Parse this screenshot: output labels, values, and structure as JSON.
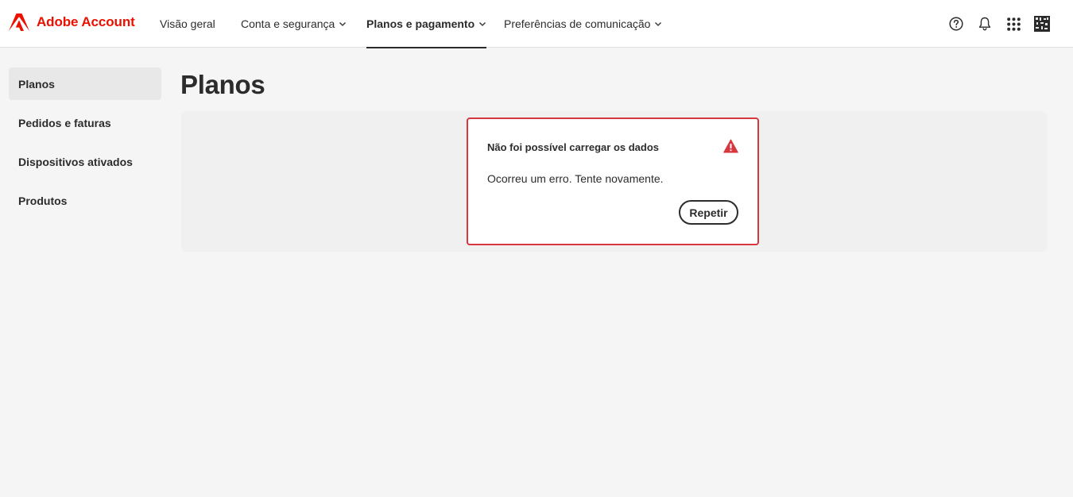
{
  "header": {
    "brand_name": "Adobe Account",
    "brand_color": "#eb1000",
    "nav": [
      {
        "label": "Visão geral",
        "has_dropdown": false,
        "active": false
      },
      {
        "label": "Conta e segurança",
        "has_dropdown": true,
        "active": false
      },
      {
        "label": "Planos e pagamento",
        "has_dropdown": true,
        "active": true
      },
      {
        "label": "Preferências de comunicação",
        "has_dropdown": true,
        "active": false
      }
    ],
    "icons": [
      "help-icon",
      "notification-bell-icon",
      "apps-grid-icon",
      "user-avatar"
    ]
  },
  "sidebar": {
    "items": [
      {
        "label": "Planos",
        "selected": true
      },
      {
        "label": "Pedidos e faturas",
        "selected": false
      },
      {
        "label": "Dispositivos ativados",
        "selected": false
      },
      {
        "label": "Produtos",
        "selected": false
      }
    ]
  },
  "main": {
    "title": "Planos",
    "alert": {
      "title": "Não foi possível carregar os dados",
      "message": "Ocorreu um erro. Tente novamente.",
      "button_label": "Repetir",
      "icon": "alert-triangle-icon",
      "border_color": "#d7373f"
    }
  }
}
